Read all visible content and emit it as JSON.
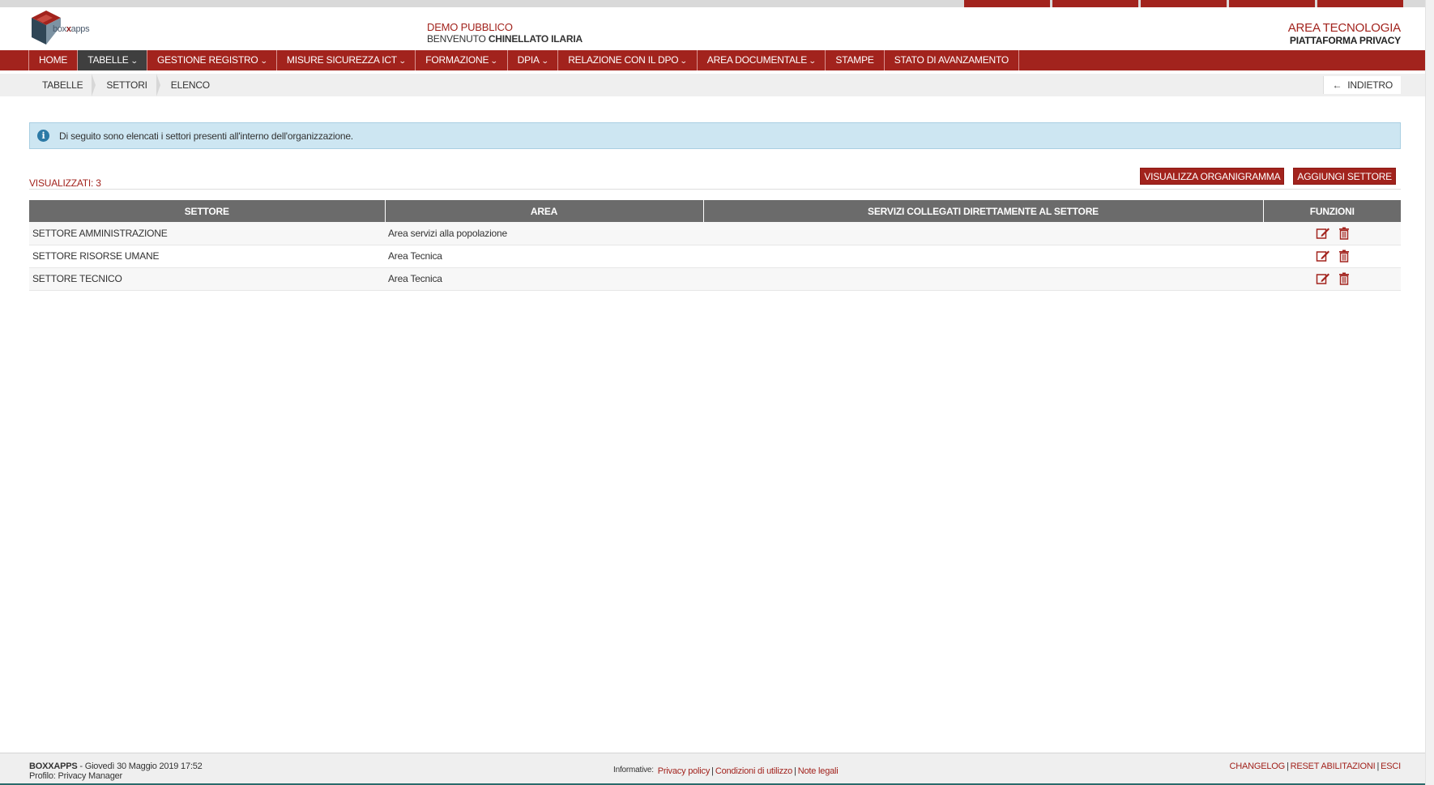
{
  "header": {
    "logo_text_prefix": "box",
    "logo_text_bold": "x",
    "logo_text_suffix": "apps",
    "org_name": "DEMO PUBBLICO",
    "welcome_label": "BENVENUTO",
    "user_name": "CHINELLATO ILARIA",
    "area_title": "AREA TECNOLOGIA",
    "area_subtitle": "PIATTAFORMA PRIVACY"
  },
  "nav": {
    "items": [
      {
        "label": "HOME",
        "dropdown": false
      },
      {
        "label": "TABELLE",
        "dropdown": true,
        "active": true
      },
      {
        "label": "GESTIONE REGISTRO",
        "dropdown": true
      },
      {
        "label": "MISURE SICUREZZA ICT",
        "dropdown": true
      },
      {
        "label": "FORMAZIONE",
        "dropdown": true
      },
      {
        "label": "DPIA",
        "dropdown": true
      },
      {
        "label": "RELAZIONE CON IL DPO",
        "dropdown": true
      },
      {
        "label": "AREA DOCUMENTALE",
        "dropdown": true
      },
      {
        "label": "STAMPE",
        "dropdown": false
      },
      {
        "label": "STATO DI AVANZAMENTO",
        "dropdown": false
      }
    ]
  },
  "breadcrumb": {
    "items": [
      "TABELLE",
      "SETTORI",
      "ELENCO"
    ],
    "back_label": "INDIETRO",
    "back_arrow": "←"
  },
  "alert": {
    "icon": "i",
    "text": "Di seguito sono elencati i settori presenti all'interno dell'organizzazione."
  },
  "toolbar": {
    "count_label": "VISUALIZZATI:",
    "count_value": "3",
    "org_chart_button": "VISUALIZZA ORGANIGRAMMA",
    "add_button": "AGGIUNGI SETTORE"
  },
  "table": {
    "headers": [
      "SETTORE",
      "AREA",
      "SERVIZI COLLEGATI DIRETTAMENTE AL SETTORE",
      "FUNZIONI"
    ],
    "rows": [
      {
        "settore": "SETTORE AMMINISTRAZIONE",
        "area": "Area servizi alla popolazione",
        "servizi": ""
      },
      {
        "settore": "SETTORE RISORSE UMANE",
        "area": "Area Tecnica",
        "servizi": ""
      },
      {
        "settore": "SETTORE TECNICO",
        "area": "Area Tecnica",
        "servizi": ""
      }
    ]
  },
  "footer": {
    "brand": "BOXXAPPS",
    "datetime": "- Giovedì 30 Maggio 2019 17:52",
    "profile": "Profilo: Privacy Manager",
    "informative_label": "Informative:",
    "links": [
      "Privacy policy",
      "Condizioni di utilizzo",
      "Note legali"
    ],
    "right_links": [
      "CHANGELOG",
      "RESET ABILITAZIONI",
      "ESCI"
    ],
    "separator": "|"
  },
  "colors": {
    "brand_red": "#a2231d",
    "nav_active": "#3f3f3f",
    "table_header": "#6b6b6b",
    "alert_bg": "#cde6f2",
    "info_icon": "#2c7aa6"
  }
}
